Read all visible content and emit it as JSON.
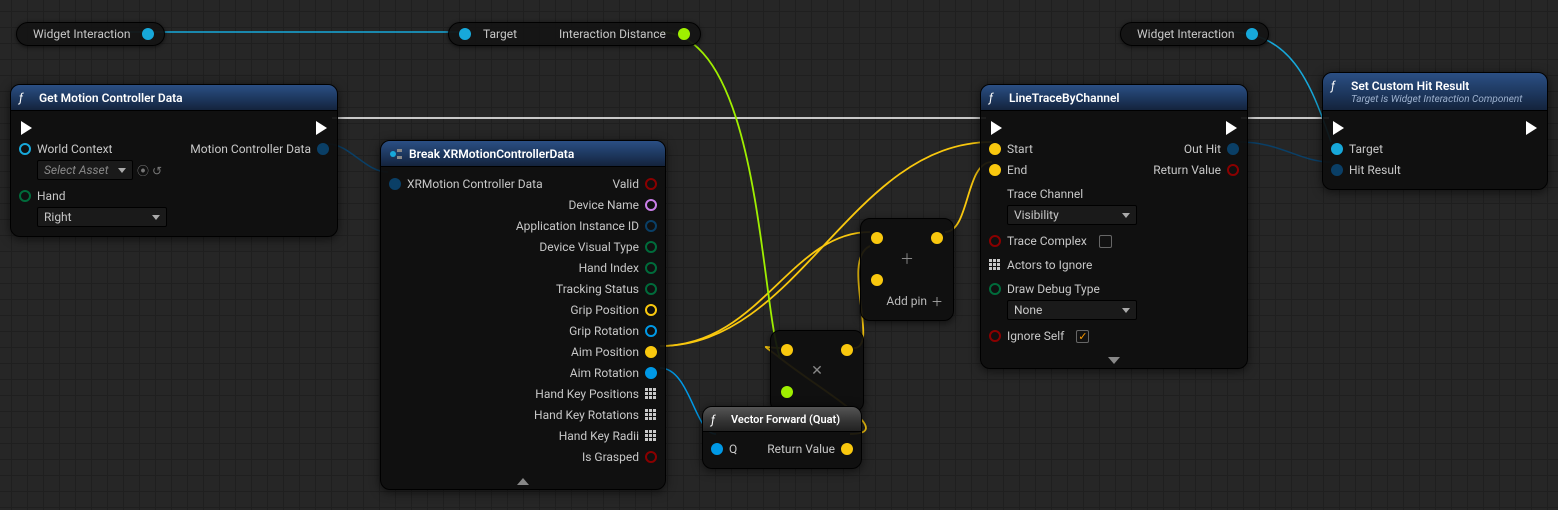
{
  "pills": {
    "widget_left": "Widget Interaction",
    "target": "Target",
    "interaction_distance": "Interaction Distance",
    "widget_right": "Widget Interaction"
  },
  "getmc": {
    "title": "Get Motion Controller Data",
    "world_context": "World Context",
    "select_asset": "Select Asset",
    "hand": "Hand",
    "hand_value": "Right",
    "out": "Motion Controller Data"
  },
  "break": {
    "title": "Break XRMotionControllerData",
    "in": "XRMotion Controller Data",
    "valid": "Valid",
    "device_name": "Device Name",
    "app_id": "Application Instance ID",
    "visual_type": "Device Visual Type",
    "hand_index": "Hand Index",
    "tracking": "Tracking Status",
    "grip_pos": "Grip Position",
    "grip_rot": "Grip Rotation",
    "aim_pos": "Aim Position",
    "aim_rot": "Aim Rotation",
    "hk_pos": "Hand Key Positions",
    "hk_rot": "Hand Key Rotations",
    "hk_rad": "Hand Key Radii",
    "grasped": "Is Grasped"
  },
  "vfw": {
    "title": "Vector Forward (Quat)",
    "q": "Q",
    "ret": "Return Value"
  },
  "add": {
    "addpin": "Add pin"
  },
  "mult": {},
  "trace": {
    "title": "LineTraceByChannel",
    "start": "Start",
    "end": "End",
    "channel": "Trace Channel",
    "channel_val": "Visibility",
    "complex": "Trace Complex",
    "actors": "Actors to Ignore",
    "debug": "Draw Debug Type",
    "debug_val": "None",
    "ignore": "Ignore Self",
    "outhit": "Out Hit",
    "retval": "Return Value"
  },
  "sethit": {
    "title": "Set Custom Hit Result",
    "sub": "Target is Widget Interaction Component",
    "target": "Target",
    "hitres": "Hit Result"
  }
}
